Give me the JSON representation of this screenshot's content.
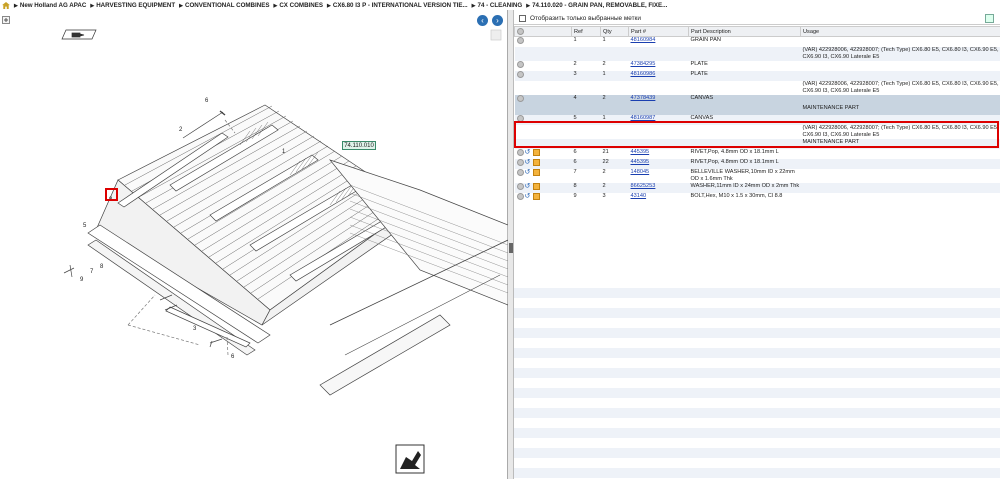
{
  "breadcrumb": {
    "items": [
      "New Holland AG APAC",
      "HARVESTING EQUIPMENT",
      "CONVENTIONAL COMBINES",
      "CX COMBINES",
      "CX6.80 I3 P - INTERNATIONAL VERSION TIE...",
      "74 - CLEANING",
      "74.110.020 - GRAIN PAN, REMOVABLE, FIXE..."
    ]
  },
  "filter": {
    "label": "Отобразить только выбранные метки"
  },
  "diagram": {
    "section_label": "74.110.010",
    "callouts": [
      "6",
      "2",
      "1",
      "8",
      "5",
      "7",
      "9",
      "8",
      "3",
      "6"
    ]
  },
  "table": {
    "headers": [
      "",
      "Ref",
      "Qty",
      "Part #",
      "Part Description",
      "Usage"
    ],
    "rows": [
      {
        "icons": "g",
        "ref": "1",
        "qty": "1",
        "part": "48160984",
        "desc": "GRAIN PAN",
        "usage": ""
      },
      {
        "icons": "",
        "ref": "",
        "qty": "",
        "part": "",
        "desc": "",
        "usage": "(VAR) 422928006, 422928007; (Tech Type) CX6.80 E5, CX6.80 I3, CX6.90 E5, CX6.90 I3, CX6.90 Laterale E5"
      },
      {
        "icons": "g",
        "ref": "2",
        "qty": "2",
        "part": "47384295",
        "desc": "PLATE",
        "usage": ""
      },
      {
        "icons": "g",
        "ref": "3",
        "qty": "1",
        "part": "48160986",
        "desc": "PLATE",
        "usage": ""
      },
      {
        "icons": "",
        "ref": "",
        "qty": "",
        "part": "",
        "desc": "",
        "usage": "(VAR) 422928006, 422928007; (Tech Type) CX6.80 E5, CX6.80 I3, CX6.90 E5, CX6.90 I3, CX6.90 Laterale E5"
      },
      {
        "icons": "g",
        "ref": "4",
        "qty": "2",
        "part": "47378439",
        "desc": "CANVAS",
        "usage": "",
        "sel": true
      },
      {
        "icons": "",
        "ref": "",
        "qty": "",
        "part": "",
        "desc": "",
        "usage": "MAINTENANCE PART",
        "sel": true
      },
      {
        "icons": "g",
        "ref": "5",
        "qty": "1",
        "part": "48160987",
        "desc": "CANVAS",
        "usage": ""
      },
      {
        "icons": "",
        "ref": "",
        "qty": "",
        "part": "",
        "desc": "",
        "usage": "(VAR) 422928006, 422928007; (Tech Type) CX6.80 E5, CX6.80 I3, CX6.90 E5, CX6.90 I3, CX6.90 Laterale E5"
      },
      {
        "icons": "",
        "ref": "",
        "qty": "",
        "part": "",
        "desc": "",
        "usage": "MAINTENANCE PART"
      },
      {
        "icons": "gab",
        "ref": "6",
        "qty": "21",
        "part": "445395",
        "desc": "RIVET,Pop, 4.8mm OD x 18.1mm L",
        "usage": ""
      },
      {
        "icons": "gab",
        "ref": "6",
        "qty": "22",
        "part": "445395",
        "desc": "RIVET,Pop, 4.8mm OD x 18.1mm L",
        "usage": ""
      },
      {
        "icons": "gab",
        "ref": "7",
        "qty": "2",
        "part": "148045",
        "desc": "BELLEVILLE WASHER,10mm ID x 22mm OD x 1.6mm Thk",
        "usage": ""
      },
      {
        "icons": "gab",
        "ref": "8",
        "qty": "2",
        "part": "86625253",
        "desc": "WASHER,11mm ID x 24mm OD x 2mm Thk",
        "usage": ""
      },
      {
        "icons": "gab",
        "ref": "9",
        "qty": "3",
        "part": "43140",
        "desc": "BOLT,Hex, M10 x 1.5 x 30mm, Cl 8.8",
        "usage": ""
      }
    ]
  }
}
